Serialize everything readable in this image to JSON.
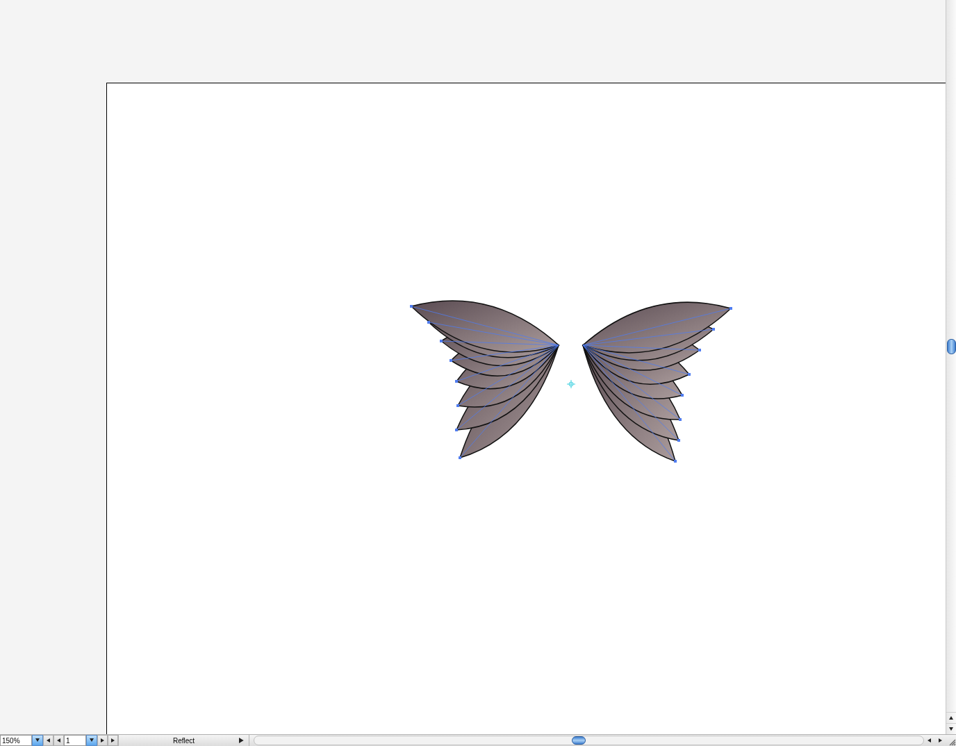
{
  "status_bar": {
    "zoom": "150%",
    "page": "1",
    "status": "Reflect"
  }
}
